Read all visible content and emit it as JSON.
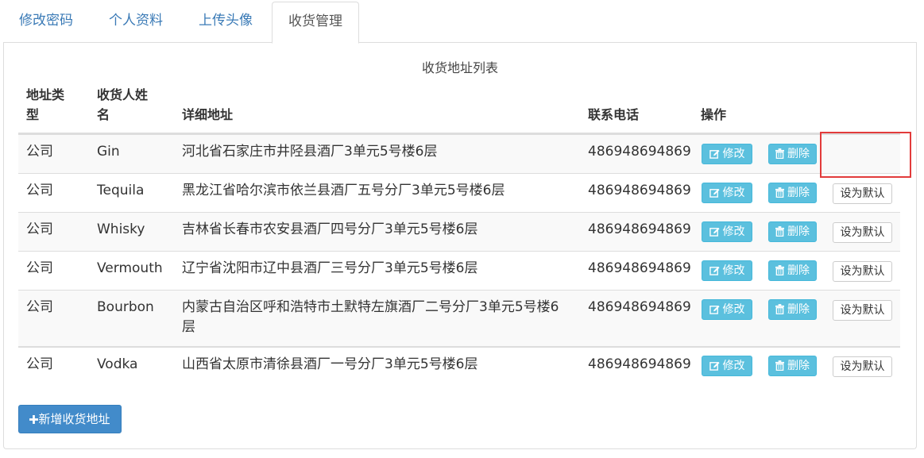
{
  "tabs": [
    {
      "label": "修改密码",
      "active": false
    },
    {
      "label": "个人资料",
      "active": false
    },
    {
      "label": "上传头像",
      "active": false
    },
    {
      "label": "收货管理",
      "active": true
    }
  ],
  "table": {
    "caption": "收货地址列表",
    "headers": {
      "type_line1": "地址类",
      "type_line2": "型",
      "name_line1": "收货人姓",
      "name_line2": "名",
      "address": "详细地址",
      "phone": "联系电话",
      "actions": "操作"
    },
    "rows": [
      {
        "type": "公司",
        "name": "Gin",
        "address": "河北省石家庄市井陉县酒厂3单元5号楼6层",
        "phone": "486948694869",
        "is_default": true
      },
      {
        "type": "公司",
        "name": "Tequila",
        "address": "黑龙江省哈尔滨市依兰县酒厂五号分厂3单元5号楼6层",
        "phone": "486948694869",
        "is_default": false
      },
      {
        "type": "公司",
        "name": "Whisky",
        "address": "吉林省长春市农安县酒厂四号分厂3单元5号楼6层",
        "phone": "486948694869",
        "is_default": false
      },
      {
        "type": "公司",
        "name": "Vermouth",
        "address": "辽宁省沈阳市辽中县酒厂三号分厂3单元5号楼6层",
        "phone": "486948694869",
        "is_default": false
      },
      {
        "type": "公司",
        "name": "Bourbon",
        "address_line1": "内蒙古自治区呼和浩特市土默特左旗酒厂二号分厂3单元5号楼6",
        "address_line2": "层",
        "phone": "486948694869",
        "is_default": false
      },
      {
        "type": "公司",
        "name": "Vodka",
        "address": "山西省太原市清徐县酒厂一号分厂3单元5号楼6层",
        "phone": "486948694869",
        "is_default": false
      }
    ]
  },
  "buttons": {
    "edit": "修改",
    "delete": "删除",
    "set_default": "设为默认",
    "add": "新增收货地址"
  },
  "icons": {
    "edit": "edit-icon",
    "delete": "trash-icon",
    "add": "plus-icon"
  },
  "colors": {
    "tab_link": "#3a7ab6",
    "info_button": "#5bc0de",
    "primary_button": "#428bca",
    "highlight": "#e23b3b"
  }
}
